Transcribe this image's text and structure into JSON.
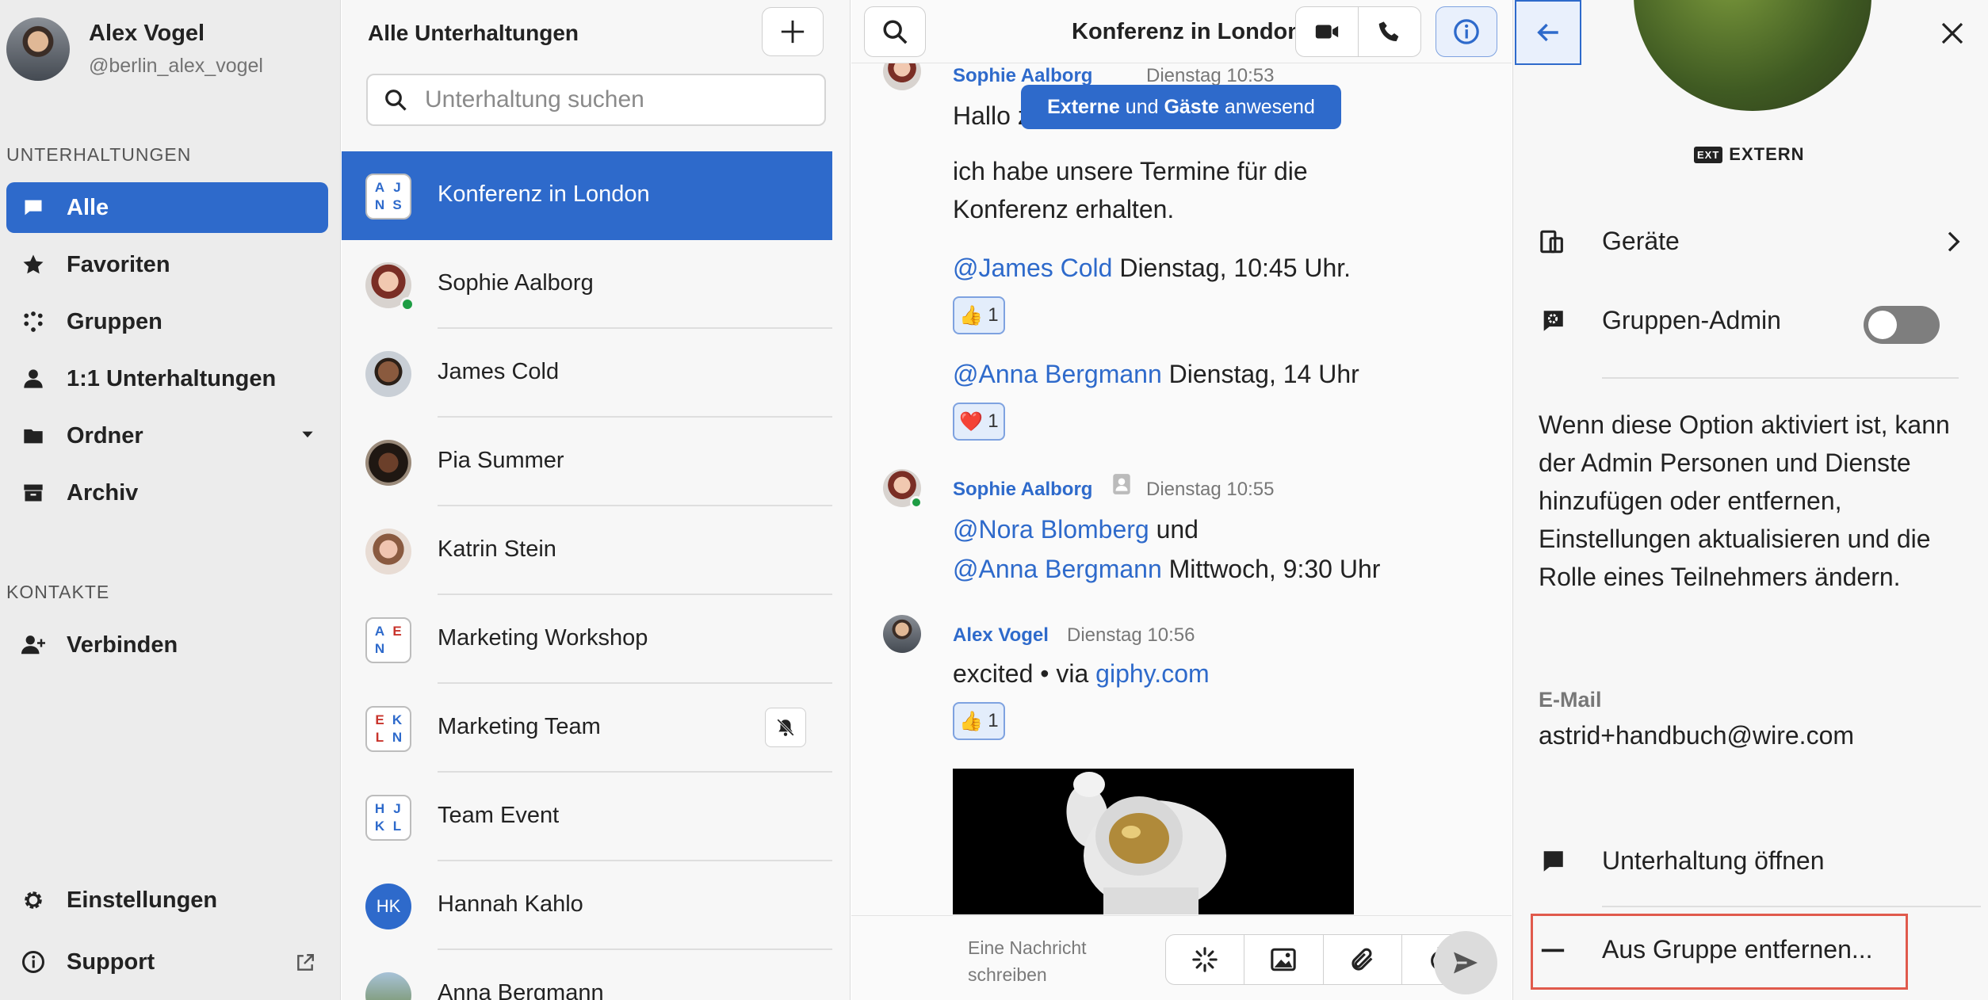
{
  "sidebar": {
    "user": {
      "name": "Alex Vogel",
      "handle": "@berlin_alex_vogel"
    },
    "section_conversations": "UNTERHALTUNGEN",
    "nav": [
      {
        "label": "Alle",
        "icon": "chat-bubble-icon",
        "active": true
      },
      {
        "label": "Favoriten",
        "icon": "star-icon"
      },
      {
        "label": "Gruppen",
        "icon": "group-dots-icon"
      },
      {
        "label": "1:1 Unterhaltungen",
        "icon": "person-icon"
      },
      {
        "label": "Ordner",
        "icon": "folder-icon"
      },
      {
        "label": "Archiv",
        "icon": "archive-icon"
      }
    ],
    "section_contacts": "KONTAKTE",
    "connect": "Verbinden",
    "settings": "Einstellungen",
    "support": "Support"
  },
  "convlist": {
    "title": "Alle Unterhaltungen",
    "search_placeholder": "Unterhaltung suchen",
    "items": [
      {
        "name": "Konferenz in London",
        "type": "group",
        "initials": [
          "A",
          "J",
          "N",
          "S"
        ],
        "active": true
      },
      {
        "name": "Sophie Aalborg",
        "type": "person",
        "online": true
      },
      {
        "name": "James Cold",
        "type": "person"
      },
      {
        "name": "Pia Summer",
        "type": "person"
      },
      {
        "name": "Katrin Stein",
        "type": "person"
      },
      {
        "name": "Marketing Workshop",
        "type": "group",
        "initials": [
          "A",
          "E",
          "N",
          ""
        ]
      },
      {
        "name": "Marketing Team",
        "type": "group",
        "initials": [
          "E",
          "K",
          "L",
          "N"
        ],
        "muted": true
      },
      {
        "name": "Team Event",
        "type": "group",
        "initials": [
          "H",
          "J",
          "K",
          "L"
        ]
      },
      {
        "name": "Hannah Kahlo",
        "type": "initials",
        "initials_text": "HK"
      },
      {
        "name": "Anna Bergmann",
        "type": "person"
      }
    ]
  },
  "chat": {
    "title": "Konferenz in London",
    "tooltip": {
      "bold1": "Externe",
      "mid": " und ",
      "bold2": "Gäste",
      "tail": " anwesend"
    },
    "msg1": {
      "sender": "Sophie Aalborg",
      "time": "Dienstag 10:53",
      "line1": "Hallo z"
    },
    "msg1_body": "ich habe unsere Termine für die Konferenz erhalten.",
    "msg1_mention1": "@James Cold",
    "msg1_after1": " Dienstag, 10:45 Uhr.",
    "reaction1": {
      "emoji": "👍",
      "count": "1"
    },
    "msg1_mention2": "@Anna Bergmann",
    "msg1_after2": " Dienstag, 14 Uhr",
    "reaction2": {
      "emoji": "❤️",
      "count": "1"
    },
    "msg2": {
      "sender": "Sophie Aalborg",
      "time": "Dienstag 10:55",
      "mention1": "@Nora Blomberg",
      "mid": " und",
      "mention2": "@Anna Bergmann",
      "tail": " Mittwoch, 9:30 Uhr"
    },
    "msg3": {
      "sender": "Alex Vogel",
      "time": "Dienstag 10:56",
      "text": "excited • via ",
      "link": "giphy.com"
    },
    "reaction3": {
      "emoji": "👍",
      "count": "1"
    },
    "composer_placeholder": "Eine Nachricht schreiben"
  },
  "panel": {
    "external_badge": "EXT",
    "external_label": "EXTERN",
    "devices": "Geräte",
    "group_admin": "Gruppen-Admin",
    "group_admin_enabled": false,
    "description": "Wenn diese Option aktiviert ist, kann der Admin Personen und Dienste hinzufügen oder entfernen, Einstellungen aktualisieren und die Rolle eines Teilnehmers ändern.",
    "email_label": "E-Mail",
    "email": "astrid+handbuch@wire.com",
    "open_conversation": "Unterhaltung öffnen",
    "remove_from_group": "Aus Gruppe entfernen..."
  },
  "colors": {
    "accent": "#2e6acb",
    "highlight_border": "#e05a4c",
    "initial_red": "#c8332b",
    "initial_blue": "#2e6acb"
  }
}
